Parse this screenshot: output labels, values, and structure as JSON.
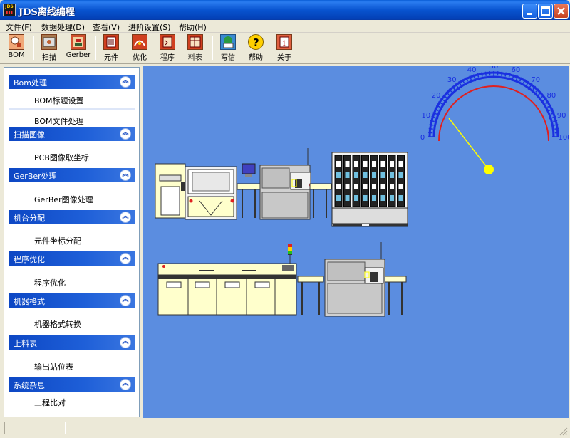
{
  "window": {
    "title": "JDS离线编程",
    "icon_text_top": "JDS",
    "icon_text_bottom": "▮▮▮"
  },
  "menu": [
    {
      "label": "文件(F)"
    },
    {
      "label": "数据处理(D)"
    },
    {
      "label": "查看(V)"
    },
    {
      "label": "进阶设置(S)"
    },
    {
      "label": "帮助(H)"
    }
  ],
  "toolbar": [
    {
      "label": "BOM",
      "icon": "bom-icon",
      "color": "#e89060"
    },
    {
      "label": "扫描",
      "icon": "scan-icon",
      "color": "#9a6a40"
    },
    {
      "label": "Gerber",
      "icon": "gerber-icon",
      "color": "#c04020"
    },
    {
      "label": "元件",
      "icon": "component-icon",
      "color": "#c03020"
    },
    {
      "label": "优化",
      "icon": "optimize-icon",
      "color": "#c03020"
    },
    {
      "label": "程序",
      "icon": "program-icon",
      "color": "#c03020"
    },
    {
      "label": "料表",
      "icon": "feeder-table-icon",
      "color": "#c03020"
    },
    {
      "label": "写信",
      "icon": "mail-icon",
      "color": "#2a8a30"
    },
    {
      "label": "帮助",
      "icon": "help-icon",
      "color": "#ffd000"
    },
    {
      "label": "关于",
      "icon": "about-icon",
      "color": "#e06040"
    }
  ],
  "sidebar": [
    {
      "header": "Bom处理",
      "items": [
        "BOM标题设置",
        "BOM文件处理"
      ]
    },
    {
      "header": "扫描图像",
      "items": [
        "PCB图像取坐标"
      ]
    },
    {
      "header": "GerBer处理",
      "items": [
        "GerBer图像处理"
      ]
    },
    {
      "header": "机台分配",
      "items": [
        "元件坐标分配"
      ]
    },
    {
      "header": "程序优化",
      "items": [
        "程序优化"
      ]
    },
    {
      "header": "机器格式",
      "items": [
        "机器格式转换"
      ]
    },
    {
      "header": "上料表",
      "items": [
        "输出站位表"
      ]
    },
    {
      "header": "系统杂息",
      "items": [
        "工程比对"
      ]
    }
  ],
  "gauge": {
    "ticks": [
      "0",
      "10",
      "20",
      "30",
      "40",
      "50",
      "60",
      "70",
      "80",
      "90",
      "100"
    ],
    "value": 15,
    "arc_color": "#1a30e0",
    "red_arc_color": "#e02020",
    "needle_color": "#ffff00"
  },
  "colors": {
    "canvas_bg": "#5b8de0",
    "sidebar_header": "#1450cc"
  }
}
